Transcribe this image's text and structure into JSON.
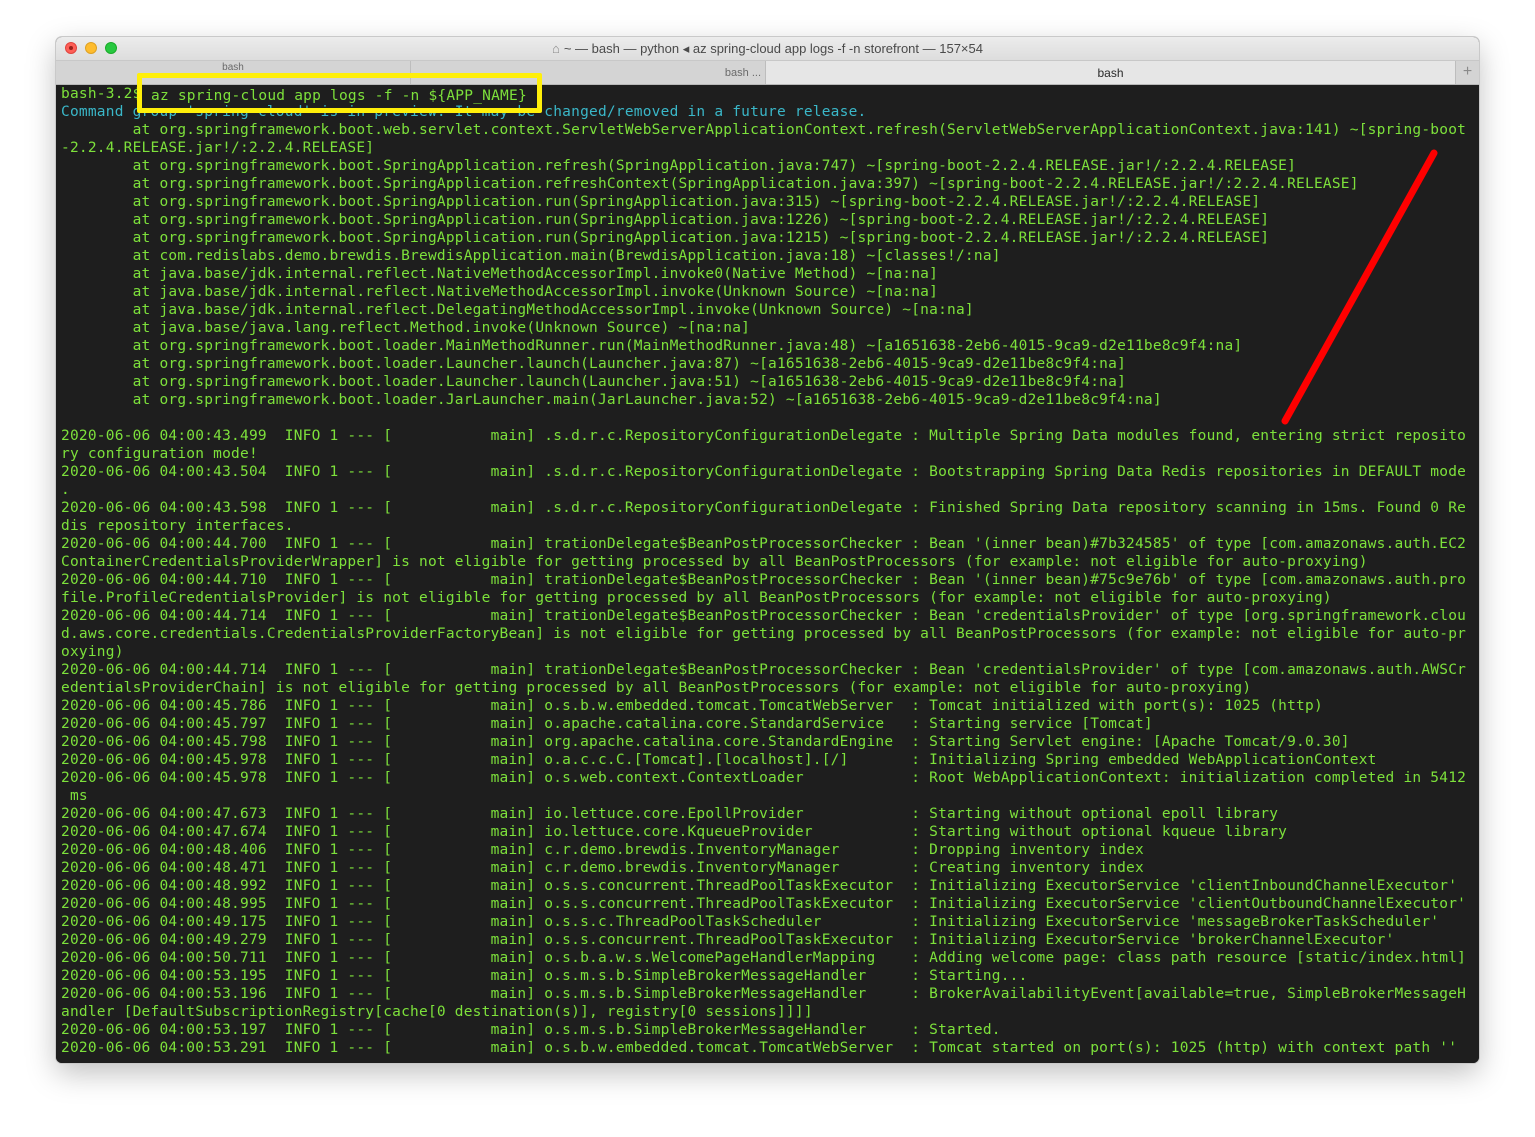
{
  "window": {
    "title": "~ — bash — python ◂ az spring-cloud app logs -f -n storefront — 157×54",
    "home_icon": "house-icon"
  },
  "tabs": [
    {
      "label": "bash"
    },
    {
      "label": "bash ..."
    },
    {
      "label": "bash"
    }
  ],
  "tab_add_label": "+",
  "highlight": {
    "command": "az spring-cloud app logs -f -n ${APP_NAME}",
    "color": "#ffef0a"
  },
  "annotation": {
    "arrow_color": "#ff0000"
  },
  "terminal": {
    "prompt_line": "bash-3.2$ az spring-cloud app logs -f -n ${APP_NAME}",
    "command_line": "Command group 'spring-cloud' is in preview. It may be changed/removed in a future release.",
    "lines": [
      "        at org.springframework.boot.web.servlet.context.ServletWebServerApplicationContext.refresh(ServletWebServerApplicationContext.java:141) ~[spring-boot",
      "-2.2.4.RELEASE.jar!/:2.2.4.RELEASE]",
      "        at org.springframework.boot.SpringApplication.refresh(SpringApplication.java:747) ~[spring-boot-2.2.4.RELEASE.jar!/:2.2.4.RELEASE]",
      "        at org.springframework.boot.SpringApplication.refreshContext(SpringApplication.java:397) ~[spring-boot-2.2.4.RELEASE.jar!/:2.2.4.RELEASE]",
      "        at org.springframework.boot.SpringApplication.run(SpringApplication.java:315) ~[spring-boot-2.2.4.RELEASE.jar!/:2.2.4.RELEASE]",
      "        at org.springframework.boot.SpringApplication.run(SpringApplication.java:1226) ~[spring-boot-2.2.4.RELEASE.jar!/:2.2.4.RELEASE]",
      "        at org.springframework.boot.SpringApplication.run(SpringApplication.java:1215) ~[spring-boot-2.2.4.RELEASE.jar!/:2.2.4.RELEASE]",
      "        at com.redislabs.demo.brewdis.BrewdisApplication.main(BrewdisApplication.java:18) ~[classes!/:na]",
      "        at java.base/jdk.internal.reflect.NativeMethodAccessorImpl.invoke0(Native Method) ~[na:na]",
      "        at java.base/jdk.internal.reflect.NativeMethodAccessorImpl.invoke(Unknown Source) ~[na:na]",
      "        at java.base/jdk.internal.reflect.DelegatingMethodAccessorImpl.invoke(Unknown Source) ~[na:na]",
      "        at java.base/java.lang.reflect.Method.invoke(Unknown Source) ~[na:na]",
      "        at org.springframework.boot.loader.MainMethodRunner.run(MainMethodRunner.java:48) ~[a1651638-2eb6-4015-9ca9-d2e11be8c9f4:na]",
      "        at org.springframework.boot.loader.Launcher.launch(Launcher.java:87) ~[a1651638-2eb6-4015-9ca9-d2e11be8c9f4:na]",
      "        at org.springframework.boot.loader.Launcher.launch(Launcher.java:51) ~[a1651638-2eb6-4015-9ca9-d2e11be8c9f4:na]",
      "        at org.springframework.boot.loader.JarLauncher.main(JarLauncher.java:52) ~[a1651638-2eb6-4015-9ca9-d2e11be8c9f4:na]",
      "",
      "2020-06-06 04:00:43.499  INFO 1 --- [           main] .s.d.r.c.RepositoryConfigurationDelegate : Multiple Spring Data modules found, entering strict reposito",
      "ry configuration mode!",
      "2020-06-06 04:00:43.504  INFO 1 --- [           main] .s.d.r.c.RepositoryConfigurationDelegate : Bootstrapping Spring Data Redis repositories in DEFAULT mode",
      ".",
      "2020-06-06 04:00:43.598  INFO 1 --- [           main] .s.d.r.c.RepositoryConfigurationDelegate : Finished Spring Data repository scanning in 15ms. Found 0 Re",
      "dis repository interfaces.",
      "2020-06-06 04:00:44.700  INFO 1 --- [           main] trationDelegate$BeanPostProcessorChecker : Bean '(inner bean)#7b324585' of type [com.amazonaws.auth.EC2",
      "ContainerCredentialsProviderWrapper] is not eligible for getting processed by all BeanPostProcessors (for example: not eligible for auto-proxying)",
      "2020-06-06 04:00:44.710  INFO 1 --- [           main] trationDelegate$BeanPostProcessorChecker : Bean '(inner bean)#75c9e76b' of type [com.amazonaws.auth.pro",
      "file.ProfileCredentialsProvider] is not eligible for getting processed by all BeanPostProcessors (for example: not eligible for auto-proxying)",
      "2020-06-06 04:00:44.714  INFO 1 --- [           main] trationDelegate$BeanPostProcessorChecker : Bean 'credentialsProvider' of type [org.springframework.clou",
      "d.aws.core.credentials.CredentialsProviderFactoryBean] is not eligible for getting processed by all BeanPostProcessors (for example: not eligible for auto-pr",
      "oxying)",
      "2020-06-06 04:00:44.714  INFO 1 --- [           main] trationDelegate$BeanPostProcessorChecker : Bean 'credentialsProvider' of type [com.amazonaws.auth.AWSCr",
      "edentialsProviderChain] is not eligible for getting processed by all BeanPostProcessors (for example: not eligible for auto-proxying)",
      "2020-06-06 04:00:45.786  INFO 1 --- [           main] o.s.b.w.embedded.tomcat.TomcatWebServer  : Tomcat initialized with port(s): 1025 (http)",
      "2020-06-06 04:00:45.797  INFO 1 --- [           main] o.apache.catalina.core.StandardService   : Starting service [Tomcat]",
      "2020-06-06 04:00:45.798  INFO 1 --- [           main] org.apache.catalina.core.StandardEngine  : Starting Servlet engine: [Apache Tomcat/9.0.30]",
      "2020-06-06 04:00:45.978  INFO 1 --- [           main] o.a.c.c.C.[Tomcat].[localhost].[/]       : Initializing Spring embedded WebApplicationContext",
      "2020-06-06 04:00:45.978  INFO 1 --- [           main] o.s.web.context.ContextLoader            : Root WebApplicationContext: initialization completed in 5412",
      " ms",
      "2020-06-06 04:00:47.673  INFO 1 --- [           main] io.lettuce.core.EpollProvider            : Starting without optional epoll library",
      "2020-06-06 04:00:47.674  INFO 1 --- [           main] io.lettuce.core.KqueueProvider           : Starting without optional kqueue library",
      "2020-06-06 04:00:48.406  INFO 1 --- [           main] c.r.demo.brewdis.InventoryManager        : Dropping inventory index",
      "2020-06-06 04:00:48.471  INFO 1 --- [           main] c.r.demo.brewdis.InventoryManager        : Creating inventory index",
      "2020-06-06 04:00:48.992  INFO 1 --- [           main] o.s.s.concurrent.ThreadPoolTaskExecutor  : Initializing ExecutorService 'clientInboundChannelExecutor'",
      "2020-06-06 04:00:48.995  INFO 1 --- [           main] o.s.s.concurrent.ThreadPoolTaskExecutor  : Initializing ExecutorService 'clientOutboundChannelExecutor'",
      "2020-06-06 04:00:49.175  INFO 1 --- [           main] o.s.s.c.ThreadPoolTaskScheduler          : Initializing ExecutorService 'messageBrokerTaskScheduler'",
      "2020-06-06 04:00:49.279  INFO 1 --- [           main] o.s.s.concurrent.ThreadPoolTaskExecutor  : Initializing ExecutorService 'brokerChannelExecutor'",
      "2020-06-06 04:00:50.711  INFO 1 --- [           main] o.s.b.a.w.s.WelcomePageHandlerMapping    : Adding welcome page: class path resource [static/index.html]",
      "2020-06-06 04:00:53.195  INFO 1 --- [           main] o.s.m.s.b.SimpleBrokerMessageHandler     : Starting...",
      "2020-06-06 04:00:53.196  INFO 1 --- [           main] o.s.m.s.b.SimpleBrokerMessageHandler     : BrokerAvailabilityEvent[available=true, SimpleBrokerMessageH",
      "andler [DefaultSubscriptionRegistry[cache[0 destination(s)], registry[0 sessions]]]]",
      "2020-06-06 04:00:53.197  INFO 1 --- [           main] o.s.m.s.b.SimpleBrokerMessageHandler     : Started.",
      "2020-06-06 04:00:53.291  INFO 1 --- [           main] o.s.b.w.embedded.tomcat.TomcatWebServer  : Tomcat started on port(s): 1025 (http) with context path ''"
    ]
  }
}
